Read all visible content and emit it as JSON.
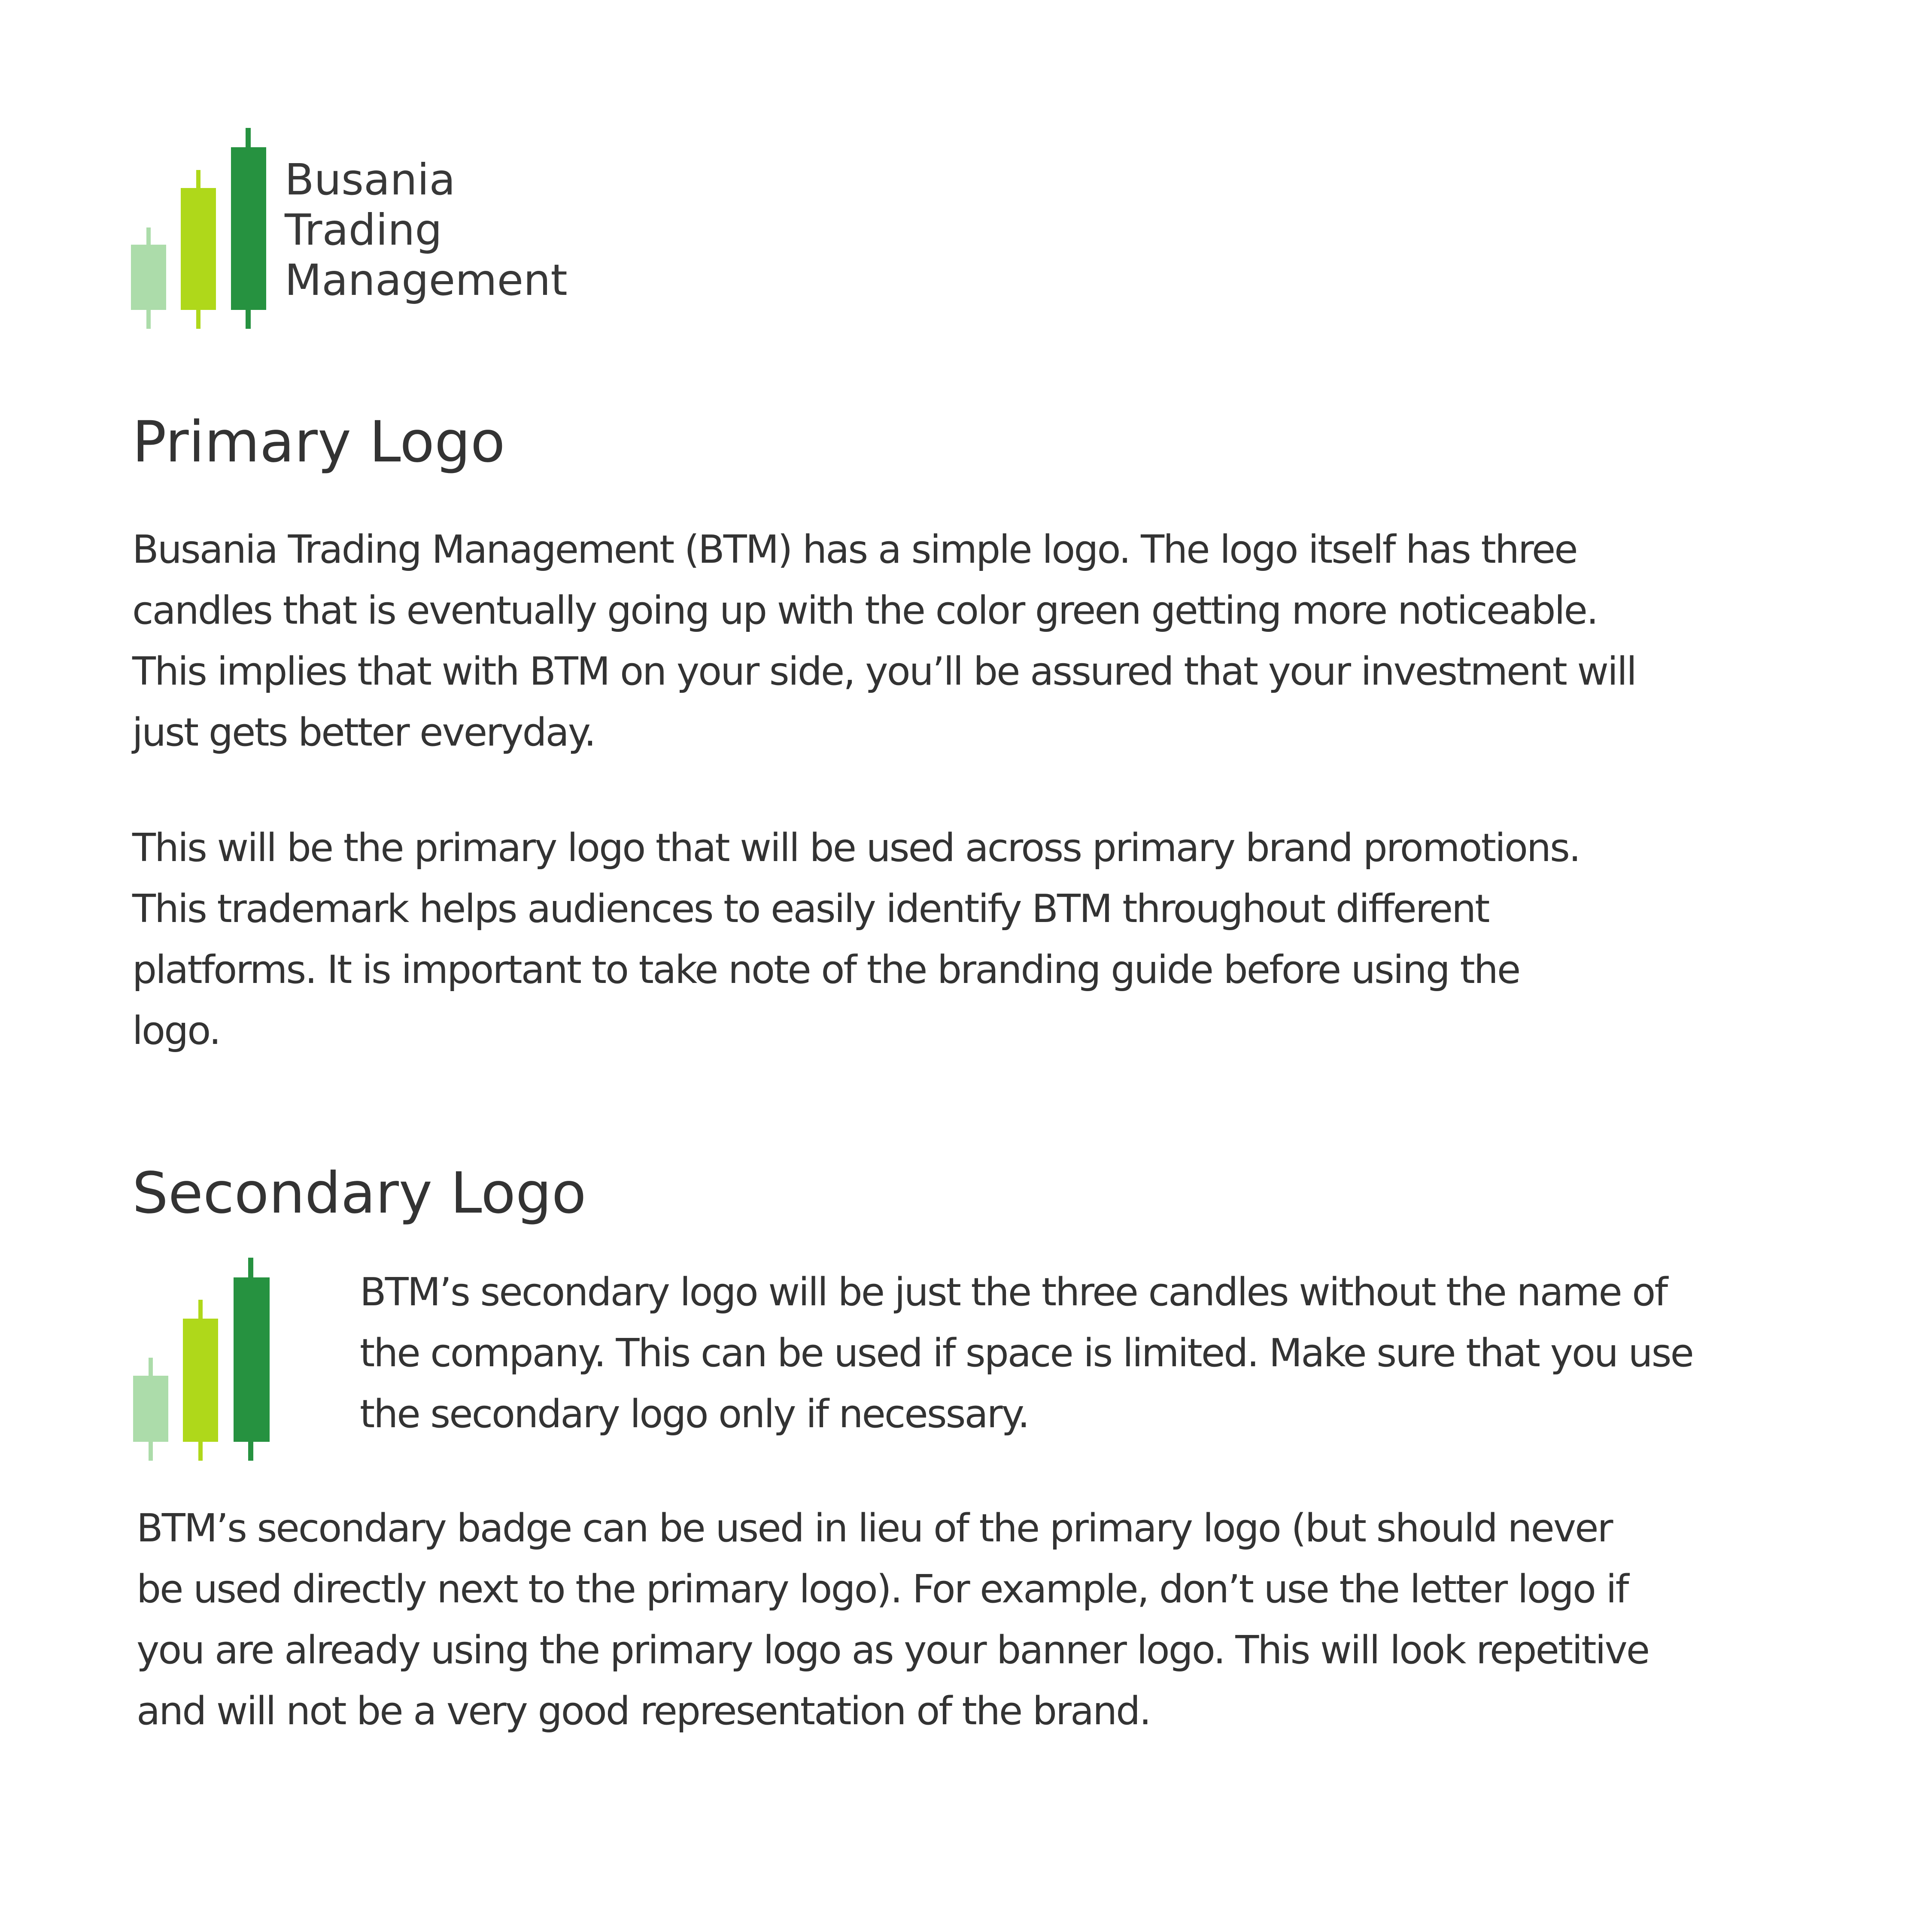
{
  "brand": {
    "name_lines": [
      "Busania",
      "Trading",
      "Management"
    ],
    "colors": {
      "candle_light": "#acdcaa",
      "candle_lime": "#afd81a",
      "candle_dark": "#269240",
      "text": "#333333"
    }
  },
  "primary": {
    "title": "Primary Logo",
    "paragraph1": [
      "Busania Trading Management (BTM) has a simple logo. The logo itself has three",
      "candles that is eventually going up with the color green getting more noticeable.",
      "This implies that with BTM on your side, you’ll be assured that your investment will",
      "just gets better everyday."
    ],
    "paragraph2": [
      "This will be the primary logo that will be used across primary brand promotions.",
      "This trademark helps audiences to easily identify BTM throughout different",
      "platforms. It is important to take note of the branding guide before using the",
      "logo."
    ]
  },
  "secondary": {
    "title": "Secondary Logo",
    "paragraph1": [
      "BTM’s secondary logo will be just the three candles without the name of",
      "the company. This can be used if space is limited. Make sure that you use",
      "the secondary logo only if necessary."
    ],
    "paragraph2": [
      "BTM’s secondary badge can be used in lieu of the primary logo (but should never",
      "be used directly next to the primary logo). For example, don’t use the letter logo if",
      "you are already using the primary logo as your banner logo. This will look repetitive",
      "and will not be a very good representation of the brand."
    ]
  }
}
